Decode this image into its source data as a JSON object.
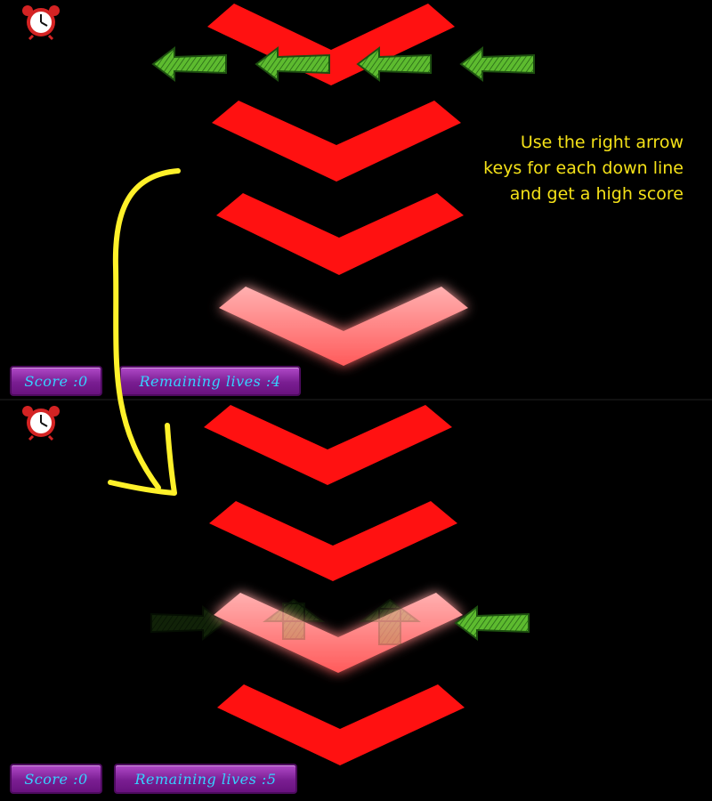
{
  "instructions": {
    "line1": "Use the right arrow",
    "line2": "keys for each down line",
    "line3": "and get a high score"
  },
  "panels": [
    {
      "score_text": "Score :0",
      "lives_text": "Remaining lives :4",
      "score": 0,
      "remaining_lives": 4,
      "chevron_count": 4,
      "highlighted_chevron": 4,
      "arrow_row": {
        "direction": "left",
        "count": 4,
        "state": "visible"
      }
    },
    {
      "score_text": "Score :0",
      "lives_text": "Remaining lives :5",
      "score": 0,
      "remaining_lives": 5,
      "chevron_count": 4,
      "highlighted_chevron": 3,
      "arrow_row": {
        "direction": "left",
        "count": 4,
        "faded_count": 3,
        "active_count": 1
      }
    }
  ],
  "icons": {
    "timer": "alarm-clock-icon",
    "target": "down-chevron-icon",
    "note": "left-arrow-icon"
  },
  "colors": {
    "background": "#000000",
    "chevron": "#ff1111",
    "chevron_glow": "#ff6b6b",
    "arrow_green": "#55b82b",
    "hud_purple": "#8a2aa3",
    "hud_text": "#36d2ff",
    "hint_text": "#f4e118",
    "guide_arrow": "#fff12a"
  }
}
